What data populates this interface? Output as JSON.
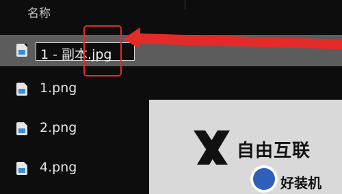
{
  "header": {
    "column_name": "名称"
  },
  "files": [
    {
      "label": "1 - 副本.jpg",
      "state": "renaming"
    },
    {
      "label": "1.png"
    },
    {
      "label": "2.png"
    },
    {
      "label": "4.png"
    }
  ],
  "watermark": {
    "brand": "自由互联",
    "app": "好装机"
  },
  "colors": {
    "background": "#0d0d0d",
    "selection": "#5c5c5c",
    "annotation_red": "#e52a2a",
    "file_icon_blue": "#3a8fd4"
  },
  "icons": {
    "file": "image-file-icon",
    "watermark_mark": "x-logo-icon"
  }
}
